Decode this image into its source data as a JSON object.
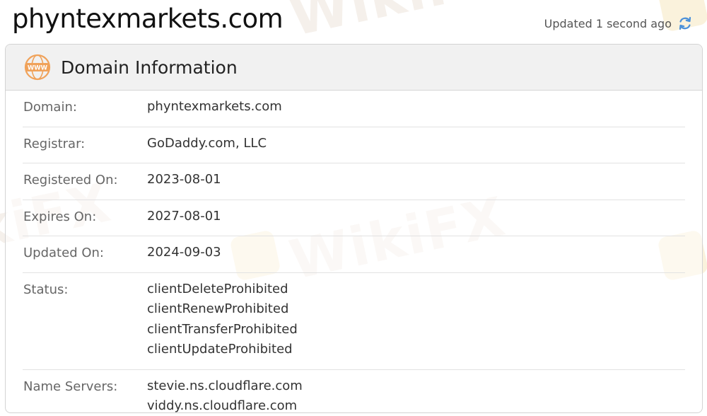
{
  "page": {
    "domain_title": "phyntexmarkets.com",
    "updated_text": "Updated 1 second ago"
  },
  "icons": {
    "refresh": "refresh-icon",
    "www": "www-icon"
  },
  "colors": {
    "accent_orange": "#f0a25a",
    "refresh_blue": "#4a90d9",
    "watermark": "#e9ded3"
  },
  "watermark_text": "WikiFX",
  "card": {
    "title": "Domain Information",
    "rows": [
      {
        "label": "Domain:",
        "values": [
          "phyntexmarkets.com"
        ]
      },
      {
        "label": "Registrar:",
        "values": [
          "GoDaddy.com, LLC"
        ]
      },
      {
        "label": "Registered On:",
        "values": [
          "2023-08-01"
        ]
      },
      {
        "label": "Expires On:",
        "values": [
          "2027-08-01"
        ]
      },
      {
        "label": "Updated On:",
        "values": [
          "2024-09-03"
        ]
      },
      {
        "label": "Status:",
        "values": [
          "clientDeleteProhibited",
          "clientRenewProhibited",
          "clientTransferProhibited",
          "clientUpdateProhibited"
        ]
      },
      {
        "label": "Name Servers:",
        "values": [
          "stevie.ns.cloudflare.com",
          "viddy.ns.cloudflare.com"
        ]
      }
    ]
  }
}
